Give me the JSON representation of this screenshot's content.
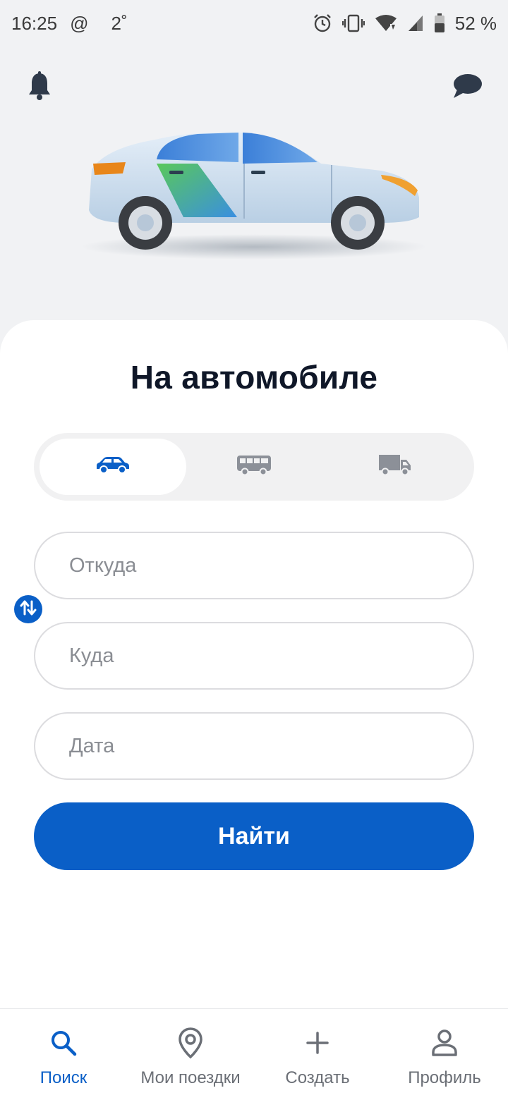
{
  "status_bar": {
    "time": "16:25",
    "at_sign": "@",
    "temperature": "2˚",
    "battery": "52 %",
    "icons": [
      "alarm-icon",
      "vibrate-icon",
      "wifi-icon",
      "signal-icon",
      "battery-icon"
    ]
  },
  "header": {
    "notifications_icon": "bell-icon",
    "messages_icon": "chat-icon"
  },
  "sheet": {
    "title": "На автомобиле"
  },
  "transport": {
    "options": [
      "car-icon",
      "bus-icon",
      "truck-icon"
    ],
    "selected": "car-icon"
  },
  "search": {
    "from_placeholder": "Откуда",
    "to_placeholder": "Куда",
    "date_placeholder": "Дата",
    "submit_label": "Найти"
  },
  "nav": {
    "items": [
      {
        "label": "Поиск",
        "icon": "search-icon",
        "active": true
      },
      {
        "label": "Мои поездки",
        "icon": "location-pin-icon",
        "active": false
      },
      {
        "label": "Создать",
        "icon": "plus-icon",
        "active": false
      },
      {
        "label": "Профиль",
        "icon": "person-icon",
        "active": false
      }
    ]
  },
  "colors": {
    "accent": "#0a5fc7",
    "background": "#f1f2f4",
    "inactive": "#6b6f76"
  }
}
